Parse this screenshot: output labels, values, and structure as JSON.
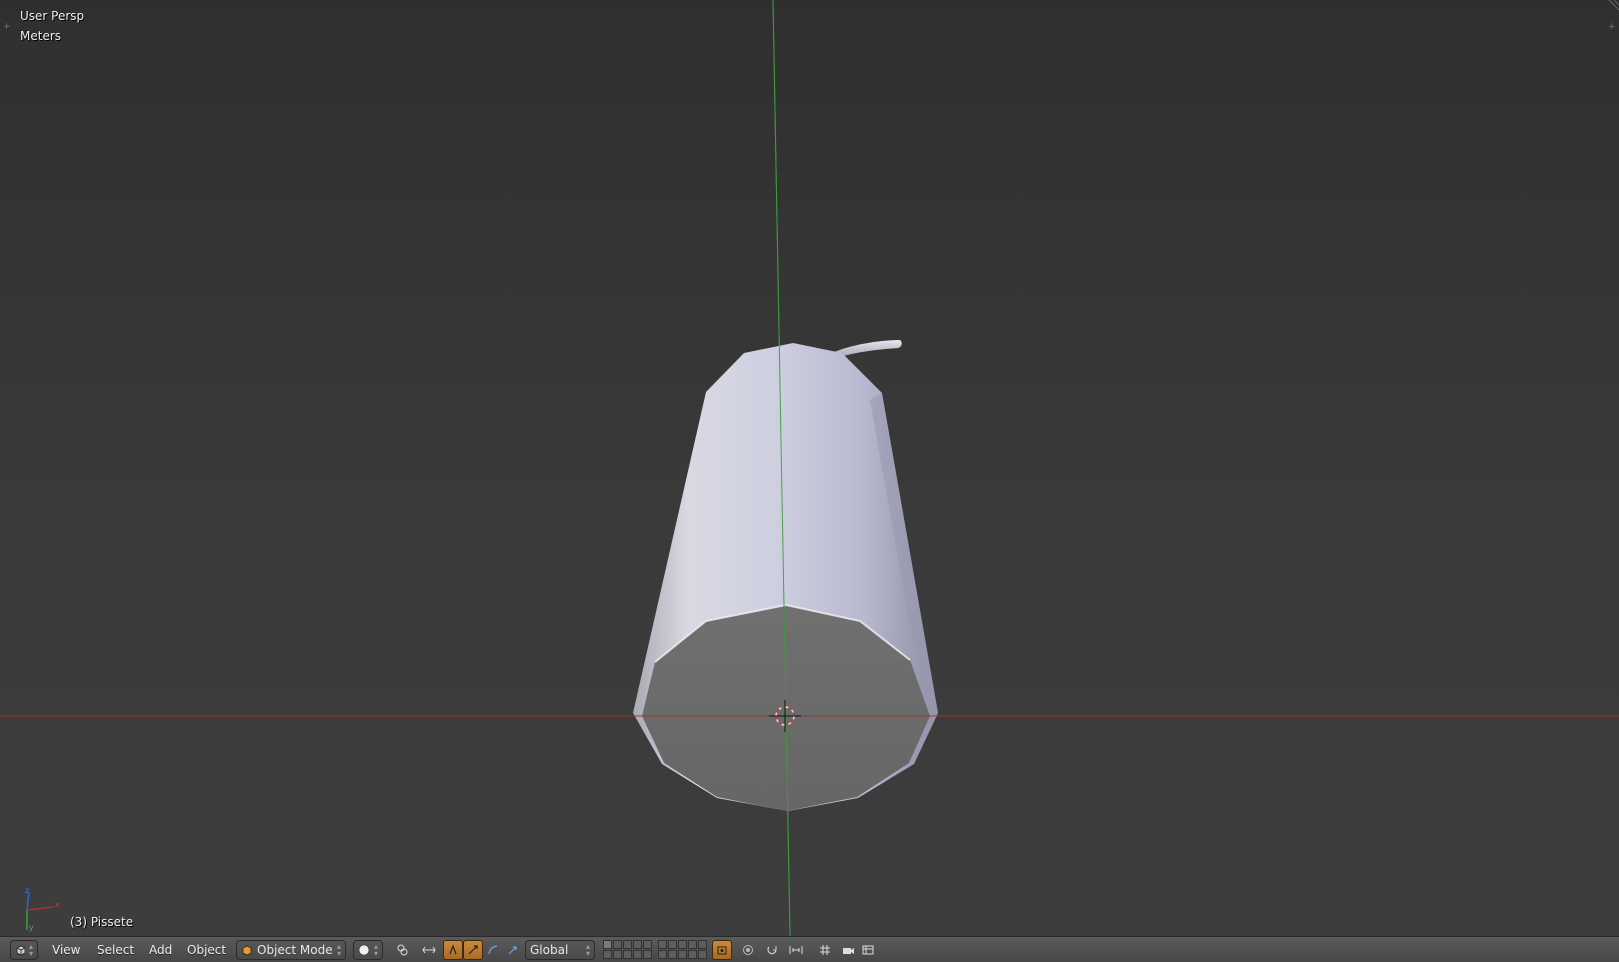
{
  "viewport": {
    "view_name": "User Persp",
    "units": "Meters",
    "object_info": "(3) Pissete"
  },
  "axis_gizmo": {
    "x_label": "x",
    "y_label": "y",
    "z_label": "z"
  },
  "colors": {
    "x_axis": "#b03030",
    "y_axis": "#3aa53a",
    "z_axis": "#3d5fc8",
    "active_button": "#c98a3c",
    "mesh_light": "#c8c8d8",
    "mesh_shade": "#7a7a88",
    "mesh_bottom": "#6e6e6e"
  },
  "header": {
    "editor_type_icon": "3d-view-icon",
    "menus": [
      "View",
      "Select",
      "Add",
      "Object"
    ],
    "mode": "Object Mode",
    "viewport_shading_icon": "solid-sphere-icon",
    "pivot_icon": "pivot-point-icon",
    "manipulator_icons": [
      "manipulator-toggle-icon",
      "translate-icon",
      "rotate-icon",
      "scale-icon"
    ],
    "transform_orientation": "Global",
    "layers_row1": [
      1,
      0,
      0,
      0,
      0,
      0,
      0,
      0,
      0,
      0
    ],
    "layers_row2": [
      0,
      0,
      0,
      0,
      0,
      0,
      0,
      0,
      0,
      0
    ],
    "right_icons": [
      "lock-camera-icon",
      "proportional-edit-icon",
      "snap-icon",
      "snap-element-icon",
      "render-preview-icon",
      "render-animation-icon"
    ]
  }
}
